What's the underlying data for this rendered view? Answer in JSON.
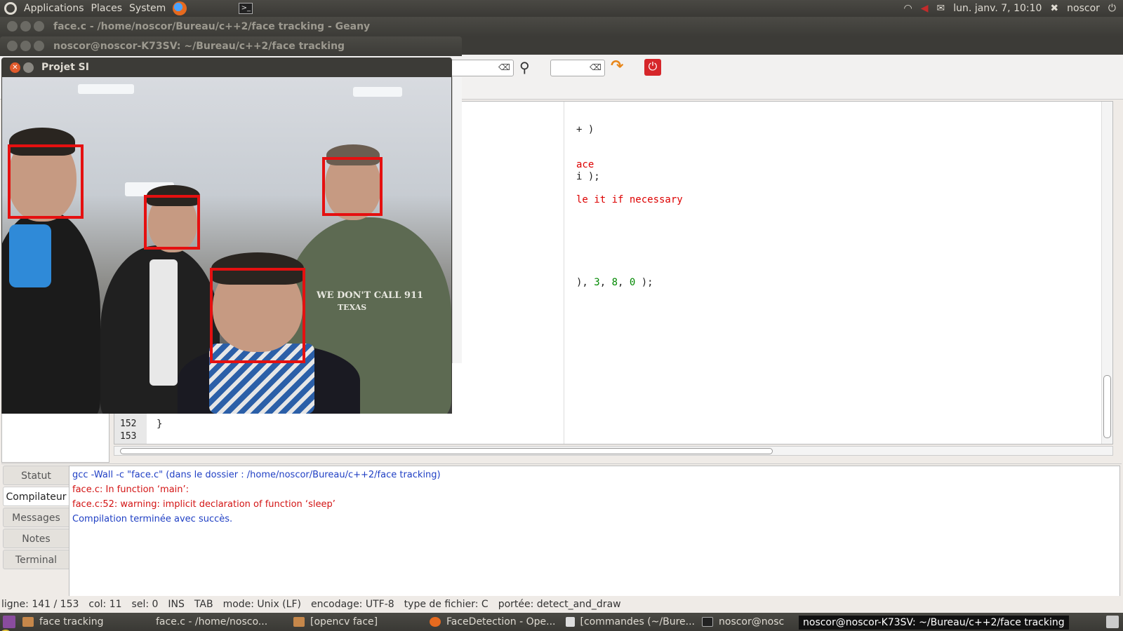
{
  "top_panel": {
    "menus": [
      "Applications",
      "Places",
      "System"
    ],
    "datetime": "lun. janv. 7, 10:10",
    "user": "noscor"
  },
  "geany": {
    "title": "face.c - /home/noscor/Bureau/c++2/face tracking - Geany",
    "code_lines": [
      {
        "text": "+ )",
        "color": "default"
      },
      {
        "text": "ace",
        "color": "red"
      },
      {
        "text": "i );",
        "color": "default"
      },
      {
        "text": "le it if necessary",
        "color": "red"
      },
      {
        "text": "), 3, 8, 0 );",
        "color": "mixed"
      }
    ],
    "line_numbers": [
      "152",
      "153"
    ],
    "last_brace": "}",
    "messages": {
      "tabs": [
        "Statut",
        "Compilateur",
        "Messages",
        "Notes",
        "Terminal"
      ],
      "active_tab": "Compilateur",
      "lines": [
        {
          "text": "gcc -Wall -c \"face.c\" (dans le dossier : /home/noscor/Bureau/c++2/face tracking)",
          "color": "blue"
        },
        {
          "text": "face.c: In function ‘main’:",
          "color": "red"
        },
        {
          "text": "face.c:52: warning: implicit declaration of function ‘sleep’",
          "color": "red"
        },
        {
          "text": "Compilation terminée avec succès.",
          "color": "blue"
        }
      ]
    },
    "status": {
      "line": "ligne: 141 / 153",
      "col": "col: 11",
      "sel": "sel: 0",
      "ins": "INS",
      "tab": "TAB",
      "mode": "mode: Unix (LF)",
      "encoding": "encodage: UTF-8",
      "filetype": "type de fichier: C",
      "scope": "portée: detect_and_draw"
    }
  },
  "terminal_window": {
    "title": "noscor@noscor-K73SV: ~/Bureau/c++2/face tracking"
  },
  "projet_window": {
    "title": "Projet SI",
    "shirt_text_1": "WE DON'T CALL 911",
    "shirt_text_2": "TEXAS",
    "faces_detected": 4
  },
  "taskbar": {
    "items": [
      {
        "label": "face tracking",
        "icon": "folder-icon"
      },
      {
        "label": "face.c - /home/nosco...",
        "icon": "geany-icon"
      },
      {
        "label": "[opencv face]",
        "icon": "folder-icon"
      },
      {
        "label": "FaceDetection - Ope...",
        "icon": "firefox-icon"
      },
      {
        "label": "[commandes (~/Bure...",
        "icon": "gedit-icon"
      },
      {
        "label": "noscor@nosc",
        "icon": "terminal-icon"
      }
    ],
    "tooltip": "noscor@noscor-K73SV: ~/Bureau/c++2/face tracking"
  },
  "colors": {
    "panel": "#3c3b37",
    "face_box": "#e51010",
    "msg_blue": "#1f3fc4",
    "msg_red": "#d31414"
  }
}
